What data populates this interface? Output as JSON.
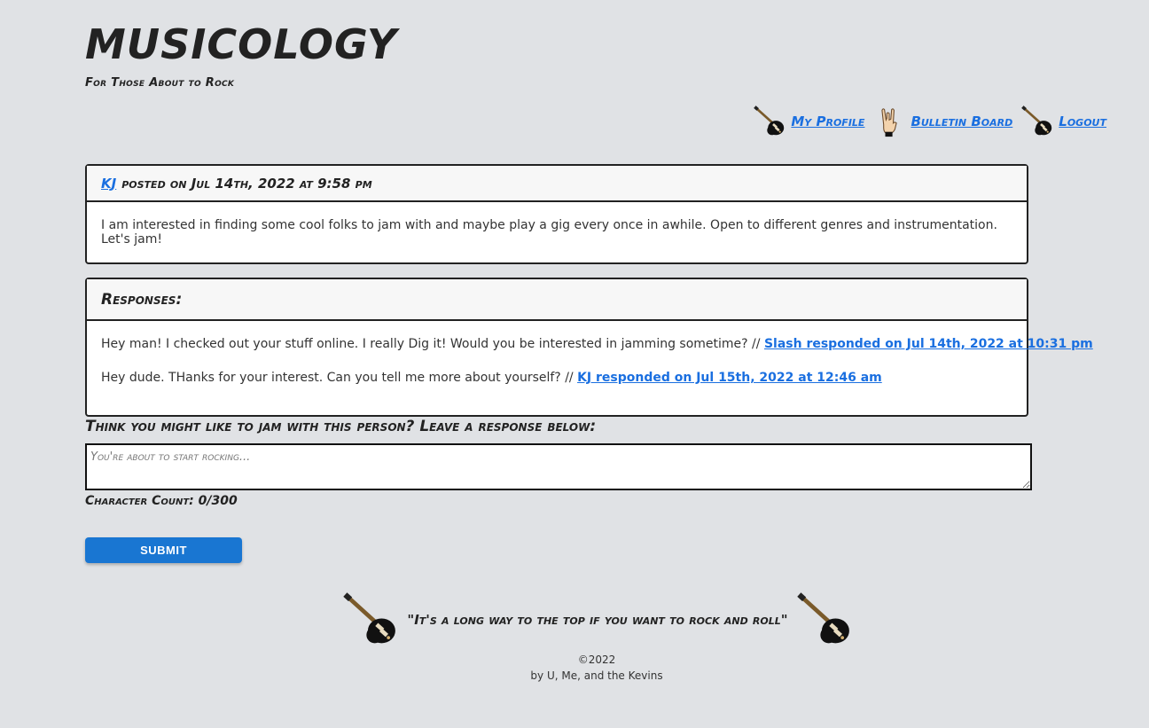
{
  "header": {
    "title": "MUSICOLOGY",
    "tagline": "For Those About to Rock"
  },
  "nav": {
    "items": [
      {
        "label": "My Profile",
        "icon": "guitar-icon"
      },
      {
        "label": "Bulletin Board",
        "icon": "rock-hand-icon"
      },
      {
        "label": "Logout",
        "icon": "guitar-icon"
      }
    ]
  },
  "post": {
    "author": "KJ",
    "meta": "posted on Jul 14th, 2022 at 9:58 pm",
    "body": "I am interested in finding some cool folks to jam with and maybe play a gig every once in awhile. Open to different genres and instrumentation. Let's jam!"
  },
  "responses": {
    "heading": "Responses:",
    "items": [
      {
        "text": "Hey man! I checked out your stuff online. I really Dig it! Would you be interested in jamming sometime? // ",
        "link": "Slash responded on Jul 14th, 2022 at 10:31 pm"
      },
      {
        "text": "Hey dude. THanks for your interest. Can you tell me more about yourself? // ",
        "link": "KJ responded on Jul 15th, 2022 at 12:46 am"
      }
    ]
  },
  "form": {
    "prompt": "Think you might like to jam with this person? Leave a response below:",
    "placeholder": "You're about to start rocking...",
    "value": "",
    "char_count": "Character Count: 0/300",
    "submit_label": "SUBMIT"
  },
  "footer": {
    "quote": "\"It's a long way to the top if you want to rock and roll\"",
    "copyright": "©2022",
    "credits": "by U, Me, and the Kevins"
  },
  "colors": {
    "background": "#e0e2e5",
    "link": "#1a6fe0",
    "button": "#1976d2"
  }
}
